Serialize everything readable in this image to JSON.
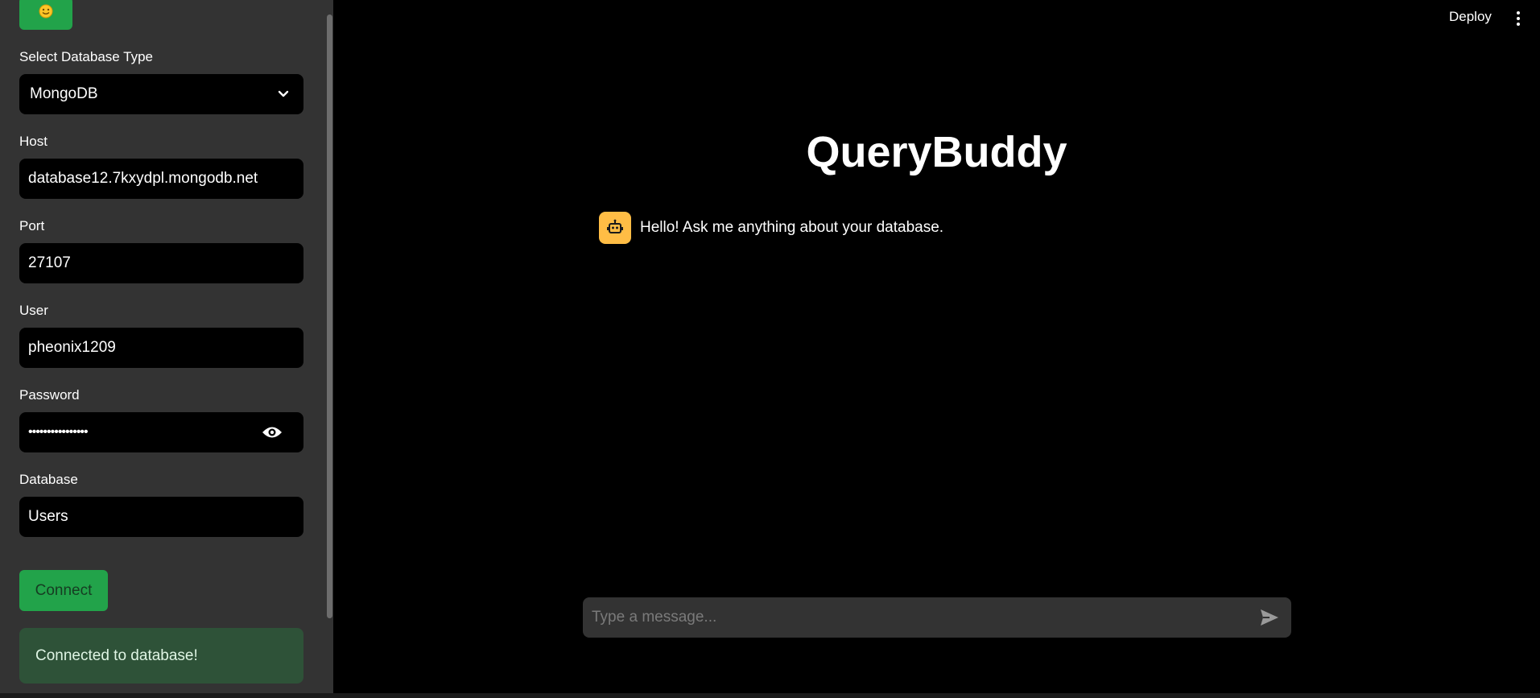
{
  "sidebar": {
    "logo_icon": "smiley-face-icon",
    "db_type_label": "Select Database Type",
    "db_type_value": "MongoDB",
    "host_label": "Host",
    "host_value": "database12.7kxydpl.mongodb.net",
    "port_label": "Port",
    "port_value": "27107",
    "user_label": "User",
    "user_value": "pheonix1209",
    "password_label": "Password",
    "password_value": "••••••••••••••••",
    "database_label": "Database",
    "database_value": "Users",
    "connect_label": "Connect",
    "status_message": "Connected to database!"
  },
  "header": {
    "deploy_label": "Deploy",
    "menu_icon": "kebab-menu-icon"
  },
  "main": {
    "title": "QueryBuddy",
    "messages": [
      {
        "role": "assistant",
        "avatar_icon": "robot-icon",
        "text": "Hello! Ask me anything about your database."
      }
    ],
    "chat_placeholder": "Type a message..."
  },
  "colors": {
    "sidebar_bg": "#333333",
    "main_bg": "#000000",
    "accent_green": "#22a34a",
    "success_bg": "#2e5238",
    "avatar_yellow": "#ffbd45"
  }
}
